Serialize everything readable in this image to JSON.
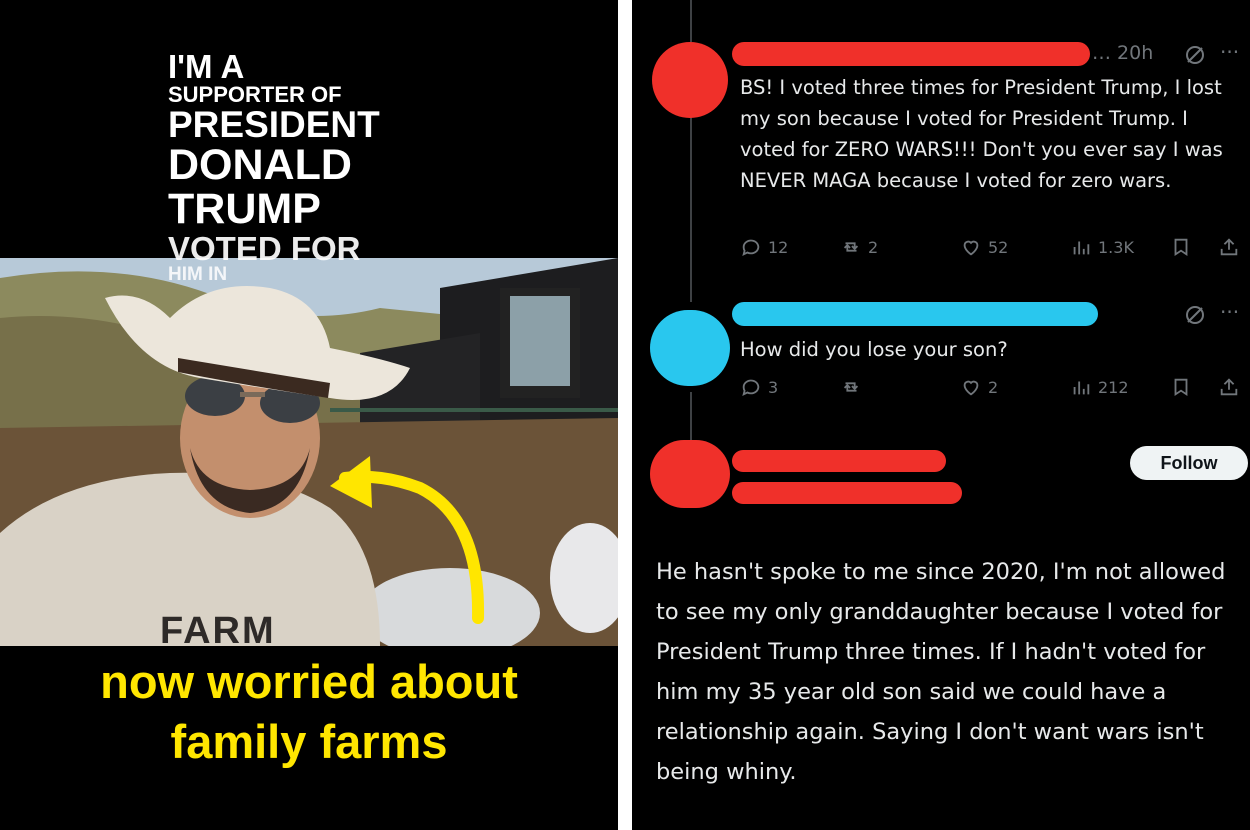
{
  "left": {
    "overlay_title": {
      "line1": "I'M A",
      "line2": "SUPPORTER OF",
      "line3": "PRESIDENT",
      "line4": "DONALD",
      "line5": "TRUMP",
      "line6": "VOTED FOR",
      "line7": "HIM IN"
    },
    "shirt_text": "FARM",
    "caption_line1": "now worried about",
    "caption_line2": "family farms",
    "caption_color": "#ffe600"
  },
  "right": {
    "reply1": {
      "time": "20h",
      "text": "BS! I voted three times for President Trump, I lost my son because I voted for President Trump. I voted for ZERO WARS!!! Don't you ever say I was NEVER MAGA because I voted for zero wars.",
      "counts": {
        "replies": "12",
        "reposts": "2",
        "likes": "52",
        "views": "1.3K"
      }
    },
    "reply2": {
      "text": "How did you lose your son?",
      "counts": {
        "replies": "3",
        "reposts": "",
        "likes": "2",
        "views": "212"
      }
    },
    "reply3": {
      "follow_label": "Follow",
      "text": "He hasn't spoke to me since 2020, I'm not allowed to see my only granddaughter because I voted for President Trump three times. If I hadn't voted for him my 35 year old son said we could have a relationship again. Saying I don't want wars isn't being whiny."
    },
    "colors": {
      "redaction_red": "#f0302a",
      "redaction_blue": "#29c7ee",
      "muted": "#71767b"
    }
  }
}
